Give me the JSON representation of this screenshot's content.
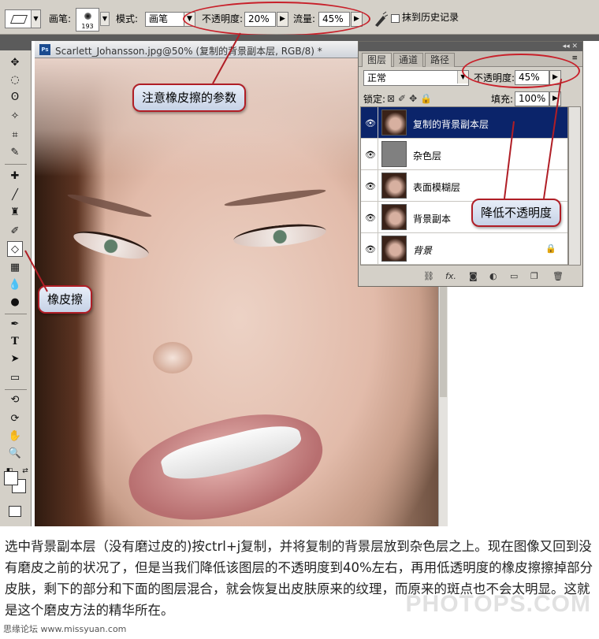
{
  "options_bar": {
    "brush_label": "画笔:",
    "brush_size": "193",
    "mode_label": "模式:",
    "mode_value": "画笔",
    "opacity_label": "不透明度:",
    "opacity_value": "20%",
    "flow_label": "流量:",
    "flow_value": "45%",
    "history_label": "抹到历史记录"
  },
  "document": {
    "title": "Scarlett_Johansson.jpg@50% (复制的背景副本层, RGB/8) *"
  },
  "layers_panel": {
    "tabs": [
      "图层",
      "通道",
      "路径"
    ],
    "blend_mode": "正常",
    "opacity_label": "不透明度:",
    "opacity_value": "45%",
    "lock_label": "锁定:",
    "fill_label": "填充:",
    "fill_value": "100%",
    "layers": [
      {
        "name": "复制的背景副本层",
        "selected": true
      },
      {
        "name": "杂色层",
        "selected": false
      },
      {
        "name": "表面模糊层",
        "selected": false
      },
      {
        "name": "背景副本",
        "selected": false
      },
      {
        "name": "背景",
        "selected": false,
        "locked": true
      }
    ]
  },
  "callouts": {
    "eraser_params": "注意橡皮擦的参数",
    "eraser": "橡皮擦",
    "lower_opacity": "降低不透明度"
  },
  "caption": "选中背景副本层（没有磨过皮的)按ctrl+j复制，并将复制的背景层放到杂色层之上。现在图像又回到没有磨皮之前的状况了，但是当我们降低该图层的不透明度到40%左右，再用低透明度的橡皮擦擦掉部分皮肤，剩下的部分和下面的图层混合，就会恢复出皮肤原来的纹理，而原来的斑点也不会太明显。这就是这个磨皮方法的精华所在。",
  "watermarks": {
    "main": "PHOTOPS.COM",
    "site": "思缘论坛 www.missyuan.com"
  },
  "colors": {
    "callout_border": "#b01e26",
    "selected_layer": "#0b246a"
  }
}
